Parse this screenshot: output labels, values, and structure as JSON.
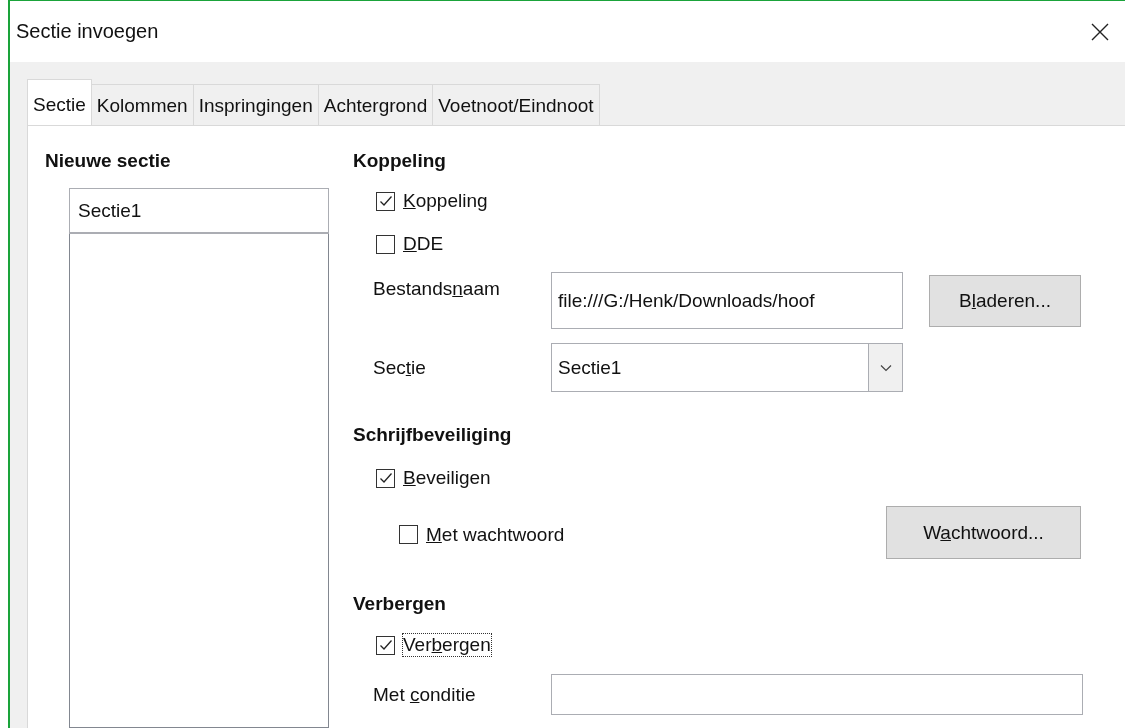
{
  "window": {
    "title": "Sectie invoegen"
  },
  "tabs": [
    {
      "label": "Sectie",
      "selected": true
    },
    {
      "label": "Kolommen",
      "selected": false
    },
    {
      "label": "Inspringingen",
      "selected": false
    },
    {
      "label": "Achtergrond",
      "selected": false
    },
    {
      "label": "Voetnoot/Eindnoot",
      "selected": false
    }
  ],
  "new_section": {
    "heading": "Nieuwe sectie",
    "name": "Sectie1"
  },
  "link": {
    "heading": "Koppeling",
    "options": [
      {
        "label": {
          "key": "K",
          "after": "oppeling"
        },
        "checked": true
      },
      {
        "label": {
          "key": "D",
          "after": "DE"
        },
        "checked": false
      }
    ],
    "file_name": {
      "label": {
        "before": "Bestands",
        "key": "n",
        "after": "aam"
      },
      "value": "file:///G:/Henk/Downloads/hoof"
    },
    "browse_button": {
      "before": "B",
      "key": "l",
      "after": "aderen..."
    },
    "section": {
      "label": {
        "before": "Sec",
        "key": "t",
        "after": "ie"
      },
      "value": "Sectie1"
    }
  },
  "write_protection": {
    "heading": "Schrijfbeveiliging",
    "protect": {
      "label": {
        "key": "B",
        "after": "eveiligen"
      },
      "checked": true
    },
    "with_password": {
      "label": {
        "key": "M",
        "after": "et wachtwoord"
      },
      "checked": false
    },
    "password_button": {
      "before": "W",
      "key": "a",
      "after": "chtwoord..."
    }
  },
  "hide": {
    "heading": "Verbergen",
    "hide": {
      "label": {
        "before": "Ver",
        "key": "b",
        "after": "ergen"
      },
      "checked": true,
      "focused": true
    },
    "condition": {
      "label": {
        "before": "Met ",
        "key": "c",
        "after": "onditie"
      }
    }
  }
}
